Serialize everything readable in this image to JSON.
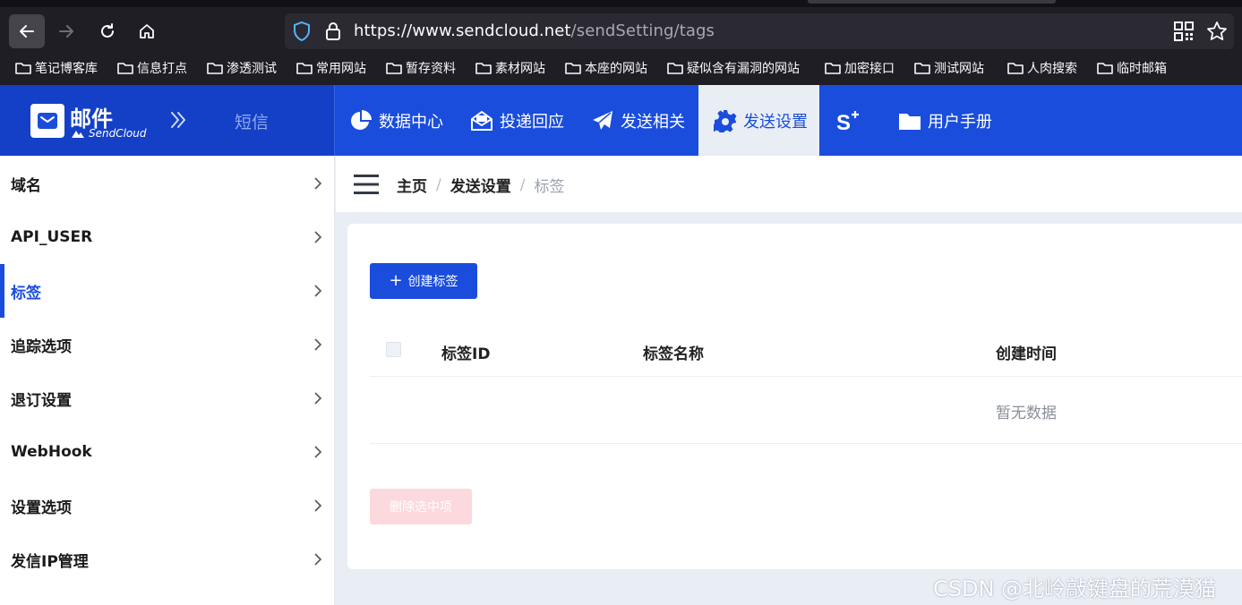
{
  "browser": {
    "url_host": "https://www.sendcloud.net",
    "url_path": "/sendSetting/tags",
    "bookmarks": [
      "笔记博客库",
      "信息打点",
      "渗透测试",
      "常用网站",
      "暂存资料",
      "素材网站",
      "本座的网站",
      "疑似含有漏洞的网站",
      "加密接口",
      "测试网站",
      "人肉搜索",
      "临时邮箱"
    ]
  },
  "header": {
    "logo_title": "邮件",
    "logo_sub": "SendCloud",
    "sms_link": "短信",
    "nav": [
      "数据中心",
      "投递回应",
      "发送相关",
      "发送设置",
      "S⁺",
      "用户手册"
    ]
  },
  "sidebar": {
    "items": [
      {
        "label": "域名"
      },
      {
        "label": "API_USER"
      },
      {
        "label": "标签"
      },
      {
        "label": "追踪选项"
      },
      {
        "label": "退订设置"
      },
      {
        "label": "WebHook"
      },
      {
        "label": "设置选项"
      },
      {
        "label": "发信IP管理"
      }
    ]
  },
  "breadcrumb": {
    "home": "主页",
    "section": "发送设置",
    "current": "标签",
    "sep": "/"
  },
  "main": {
    "create_button": "创建标签",
    "columns": [
      "标签ID",
      "标签名称",
      "创建时间"
    ],
    "empty_text": "暂无数据",
    "delete_button": "删除选中项"
  },
  "watermark": "CSDN @北岭敲键盘的荒漠猫",
  "colors": {
    "brand": "#1a4ddc",
    "brand_dark": "#1440c7",
    "danger_light": "#fbd9dc"
  }
}
